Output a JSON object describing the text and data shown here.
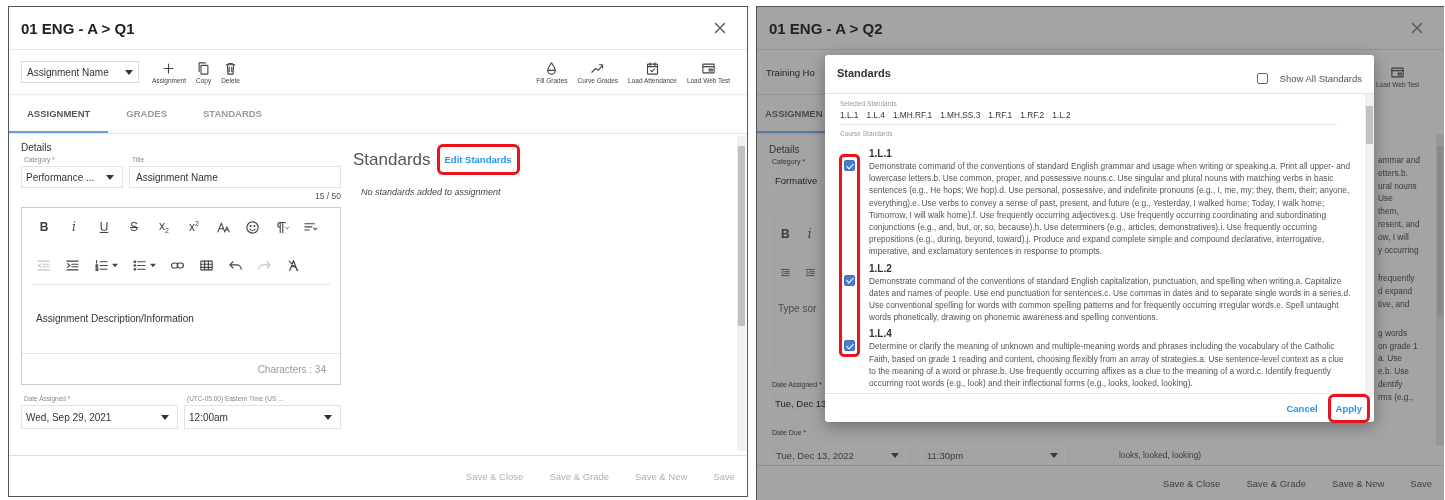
{
  "left_dialog": {
    "title": "01 ENG - A > Q1",
    "toolbar": {
      "dropdown": "Assignment Name",
      "actions": [
        {
          "kind": "add",
          "label": "Assignment"
        },
        {
          "kind": "copy",
          "label": "Copy"
        },
        {
          "kind": "delete",
          "label": "Delete"
        }
      ],
      "right_actions": [
        {
          "kind": "fill",
          "label": "Fill Grades"
        },
        {
          "kind": "curve",
          "label": "Curve Grades"
        },
        {
          "kind": "attendance",
          "label": "Load Attendance"
        },
        {
          "kind": "web_test",
          "label": "Load Web Test"
        }
      ]
    },
    "tabs": [
      {
        "label": "ASSIGNMENT",
        "selected": true
      },
      {
        "label": "GRADES",
        "selected": false
      },
      {
        "label": "STANDARDS",
        "selected": false
      }
    ],
    "details": {
      "heading": "Details",
      "category": {
        "label": "Category *",
        "value": "Performance ..."
      },
      "title_field": {
        "label": "Title",
        "value": "Assignment Name",
        "counter": "15 / 50"
      },
      "editor": {
        "row_1": [
          {
            "kind": "bold",
            "label": "B"
          },
          {
            "kind": "italic",
            "label": "i"
          },
          {
            "kind": "underline",
            "label": "U"
          },
          {
            "kind": "strike",
            "label": "S"
          },
          {
            "kind": "subscript",
            "label": "x$_{2}$"
          },
          {
            "kind": "superscript",
            "label": "x$^{2}$"
          },
          {
            "kind": "font",
            "disabled": false
          },
          {
            "kind": "emoji",
            "disabled": false
          },
          {
            "kind": "paragraph",
            "disabled": false
          },
          {
            "kind": "align",
            "disabled": false
          }
        ],
        "row_2": [
          {
            "kind": "outdent",
            "disabled": true
          },
          {
            "kind": "indent",
            "disabled": false
          },
          {
            "kind": "ordered",
            "disabled": false
          },
          {
            "kind": "bullets",
            "disabled": false
          },
          {
            "kind": "link",
            "disabled": false
          },
          {
            "kind": "table",
            "disabled": false
          },
          {
            "kind": "undo",
            "disabled": false
          },
          {
            "kind": "redo",
            "disabled": true
          },
          {
            "kind": "clear",
            "disabled": false
          }
        ],
        "content": "Assignment Description/Information",
        "char_count": "Characters : 34"
      },
      "date": {
        "label": "Date Assigned *",
        "value": "Wed, Sep 29, 2021"
      },
      "time": {
        "label": "(UTC-05:00) Eastern Time (US ...",
        "value": "12:00am"
      }
    },
    "standards": {
      "heading": "Standards",
      "edit_link": "Edit Standards",
      "highlighted": true,
      "empty_message": "No standards added to assignment"
    },
    "footer": [
      {
        "label": "Save & Close",
        "disabled": true
      },
      {
        "label": "Save & Grade",
        "disabled": true
      },
      {
        "label": "Save & New",
        "disabled": true
      },
      {
        "label": "Save",
        "disabled": true
      }
    ]
  },
  "right_dialog": {
    "title": "01 ENG - A > Q2",
    "toolbar_dropdown": "Training Ho",
    "toolbar_action": {
      "kind": "web_test",
      "label": "Load Web Test"
    },
    "tab": {
      "label": "ASSIGNMEN",
      "selected": true
    },
    "details_heading": "Details",
    "category": {
      "label": "Category *",
      "value": "Formative"
    },
    "editor": {
      "row_1": [
        {
          "kind": "bold",
          "label": "B"
        },
        {
          "kind": "italic",
          "label": "i"
        }
      ],
      "row_2": [
        {
          "kind": "outdent",
          "disabled": false
        },
        {
          "kind": "indent",
          "disabled": false
        }
      ],
      "placeholder": "Type sor"
    },
    "date_assigned": {
      "label": "Date Assigned *",
      "value": "Tue, Dec 13"
    },
    "date_due": {
      "label": "Date Due *",
      "value": "Tue, Dec 13, 2022"
    },
    "time_value": "11:30pm",
    "description_fragments": [
      [
        "ammar and",
        "etters.b.",
        "ural nouns",
        "Use",
        "them,",
        "resent, and",
        "ow, I will",
        "y occurring"
      ],
      [
        "frequently",
        "d expand",
        "tive, and"
      ],
      [
        "g words",
        "on grade 1",
        "a. Use",
        "e.b. Use",
        "dentify",
        "rms (e.g.,"
      ]
    ],
    "description_tail": "looks, looked, looking)",
    "footer": [
      {
        "label": "Save & Close",
        "disabled": true
      },
      {
        "label": "Save & Grade",
        "disabled": true
      },
      {
        "label": "Save & New",
        "disabled": true
      },
      {
        "label": "Save",
        "disabled": true
      }
    ]
  },
  "standards_modal": {
    "title": "Standards",
    "show_all": {
      "label": "Show All Standards",
      "checked": false
    },
    "selected_label": "Selected Standards",
    "selected": [
      "1.L.1",
      "1.L.4",
      "1.MH.RF.1",
      "1.MH.SS.3",
      "1.RF.1",
      "1.RF.2",
      "1.L.2"
    ],
    "course_label": "Course Standards",
    "checkboxes_highlighted": true,
    "items": [
      {
        "code": "1.L.1",
        "checked": true,
        "description": "Demonstrate command of the conventions of standard English grammar and usage when writing or speaking.a. Print all upper- and lowercase letters.b. Use common, proper, and possessive nouns.c. Use singular and plural nouns with matching verbs in basic sentences (e.g., He hops; We hop).d. Use personal, possessive, and indefinite pronouns (e.g., I, me, my; they, them, their; anyone, everything).e. Use verbs to convey a sense of past, present, and future (e.g., Yesterday, I walked home; Today, I walk home; Tomorrow, I will walk home).f. Use frequently occurring adjectives.g. Use frequently occurring coordinating and subordinating conjunctions (e.g., and, but, or, so, because).h. Use determiners (e.g., articles, demonstratives).i. Use frequently occurring prepositions (e.g., during, beyond, toward).j. Produce and expand complete simple and compound declarative, interrogative, imperative, and exclamatory sentences in response to prompts."
      },
      {
        "code": "1.L.2",
        "checked": true,
        "description": "Demonstrate command of the conventions of standard English capitalization, punctuation, and spelling when writing.a. Capitalize dates and names of people. Use end punctuation for sentences.c. Use commas in dates and to separate single words in a series.d. Use conventional spelling for words with common spelling patterns and for frequently occurring irregular words.e. Spell untaught words phonetically, drawing on phonemic awareness and spelling conventions."
      },
      {
        "code": "1.L.4",
        "checked": true,
        "description": "Determine or clarify the meaning of unknown and multiple-meaning words and phrases including the vocabulary of the Catholic Faith, based on grade 1 reading and content, choosing flexibly from an array of strategies.a. Use sentence-level context as a clue to the meaning of a word or phrase.b. Use frequently occurring affixes as a clue to the meaning of a word.c. Identify frequently occurring root words (e.g., look) and their inflectional forms (e.g., looks, looked, looking)."
      }
    ],
    "buttons": [
      {
        "label": "Cancel",
        "highlighted": false
      },
      {
        "label": "Apply",
        "highlighted": true
      }
    ]
  }
}
